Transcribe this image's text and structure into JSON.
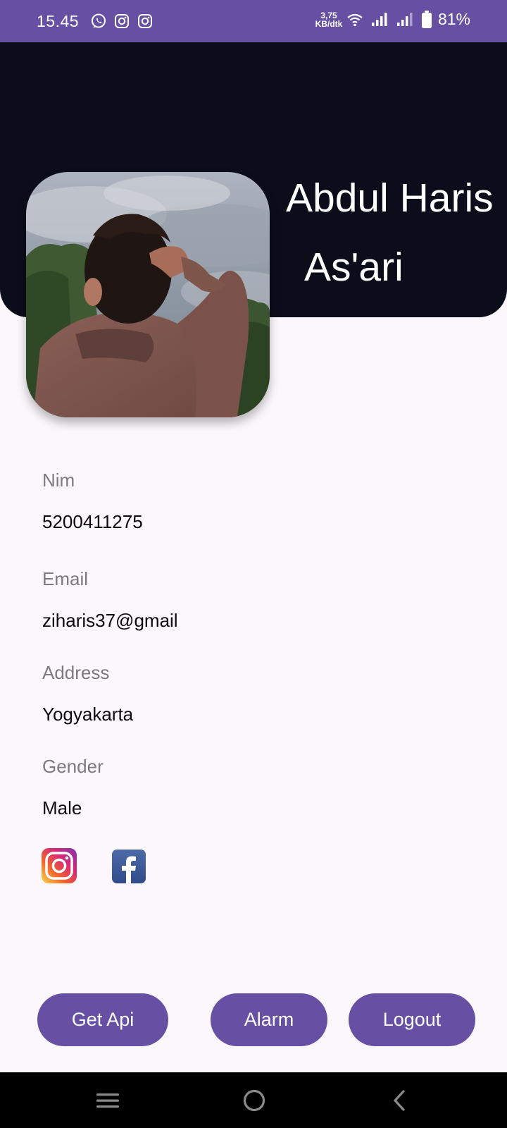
{
  "status_bar": {
    "time": "15.45",
    "net_speed_value": "3,75",
    "net_speed_unit": "KB/dtk",
    "battery_percent": "81%",
    "bg_color": "#6750a4"
  },
  "profile": {
    "name_line_1": "Abdul Haris",
    "name_line_2": "As'ari"
  },
  "fields": [
    {
      "label": "Nim",
      "value": "5200411275"
    },
    {
      "label": "Email",
      "value": "ziharis37@gmail"
    },
    {
      "label": "Address",
      "value": "Yogyakarta"
    },
    {
      "label": "Gender",
      "value": "Male"
    }
  ],
  "social": {
    "icons": [
      "instagram-icon",
      "facebook-icon"
    ]
  },
  "buttons": {
    "get_api": "Get Api",
    "alarm": "Alarm",
    "logout": "Logout"
  },
  "theme": {
    "accent": "#6750a4",
    "header_bg": "#0b0d1a",
    "page_bg": "#fcf7fc"
  }
}
